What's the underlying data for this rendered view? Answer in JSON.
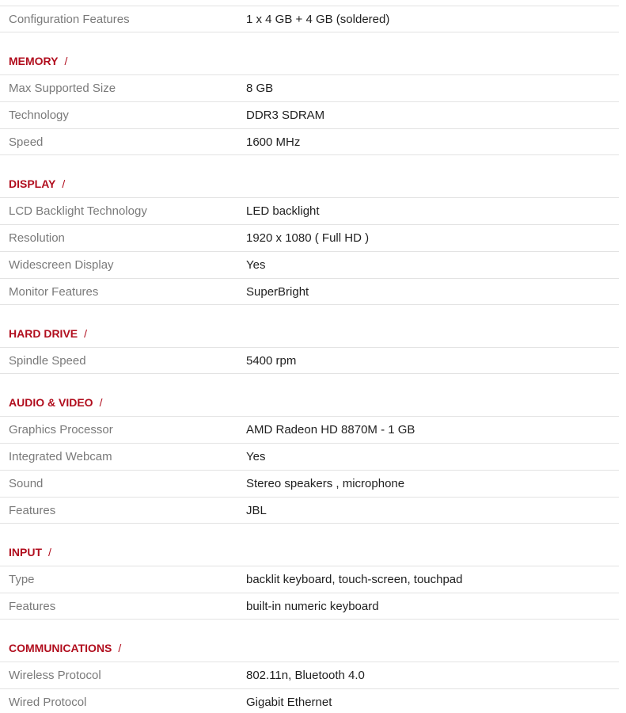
{
  "top": {
    "rows": [
      {
        "label": "Configuration Features",
        "value": "1 x 4 GB + 4 GB (soldered)"
      }
    ]
  },
  "sections": [
    {
      "title": "MEMORY",
      "separator": "/",
      "rows": [
        {
          "label": "Max Supported Size",
          "value": "8 GB"
        },
        {
          "label": "Technology",
          "value": "DDR3 SDRAM"
        },
        {
          "label": "Speed",
          "value": "1600 MHz"
        }
      ]
    },
    {
      "title": "DISPLAY",
      "separator": "/",
      "rows": [
        {
          "label": "LCD Backlight Technology",
          "value": "LED backlight"
        },
        {
          "label": "Resolution",
          "value": "1920 x 1080 ( Full HD )"
        },
        {
          "label": "Widescreen Display",
          "value": "Yes"
        },
        {
          "label": "Monitor Features",
          "value": "SuperBright"
        }
      ]
    },
    {
      "title": "HARD DRIVE",
      "separator": "/",
      "rows": [
        {
          "label": "Spindle Speed",
          "value": "5400 rpm"
        }
      ]
    },
    {
      "title": "AUDIO & VIDEO",
      "separator": "/",
      "rows": [
        {
          "label": "Graphics Processor",
          "value": "AMD Radeon HD 8870M - 1 GB"
        },
        {
          "label": "Integrated Webcam",
          "value": "Yes"
        },
        {
          "label": "Sound",
          "value": "Stereo speakers , microphone"
        },
        {
          "label": "Features",
          "value": "JBL"
        }
      ]
    },
    {
      "title": "INPUT",
      "separator": "/",
      "rows": [
        {
          "label": "Type",
          "value": "backlit keyboard, touch-screen, touchpad"
        },
        {
          "label": "Features",
          "value": "built-in numeric keyboard"
        }
      ]
    },
    {
      "title": "COMMUNICATIONS",
      "separator": "/",
      "rows": [
        {
          "label": "Wireless Protocol",
          "value": "802.11n, Bluetooth 4.0"
        },
        {
          "label": "Wired Protocol",
          "value": "Gigabit Ethernet"
        }
      ]
    }
  ]
}
